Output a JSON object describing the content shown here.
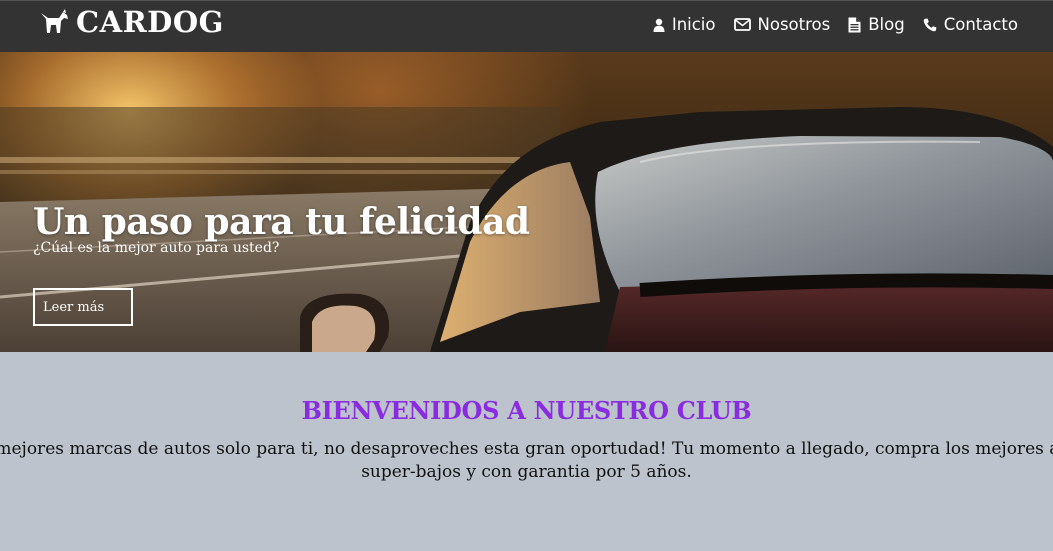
{
  "brand": {
    "name": "CARDOG",
    "icon": "dog-icon"
  },
  "nav": [
    {
      "label": "Inicio",
      "icon": "user-icon"
    },
    {
      "label": "Nosotros",
      "icon": "envelope-icon"
    },
    {
      "label": "Blog",
      "icon": "document-icon"
    },
    {
      "label": "Contacto",
      "icon": "phone-icon"
    }
  ],
  "hero": {
    "title": "Un paso para tu felicidad",
    "subtitle": "¿Cúal es la mejor auto para usted?",
    "button_label": "Leer más"
  },
  "welcome": {
    "title": "BIENVENIDOS A NUESTRO CLUB",
    "text_line1": "os las mejores marcas de autos solo para ti, no desaproveches esta gran oportudad! Tu momento a llegado, compra los mejores autos a",
    "text_line2": "super-bajos y con garantia por 5 años."
  },
  "colors": {
    "navbar": "#333333",
    "welcome_bg": "#bcc3cc",
    "welcome_title": "#8a2be2"
  }
}
